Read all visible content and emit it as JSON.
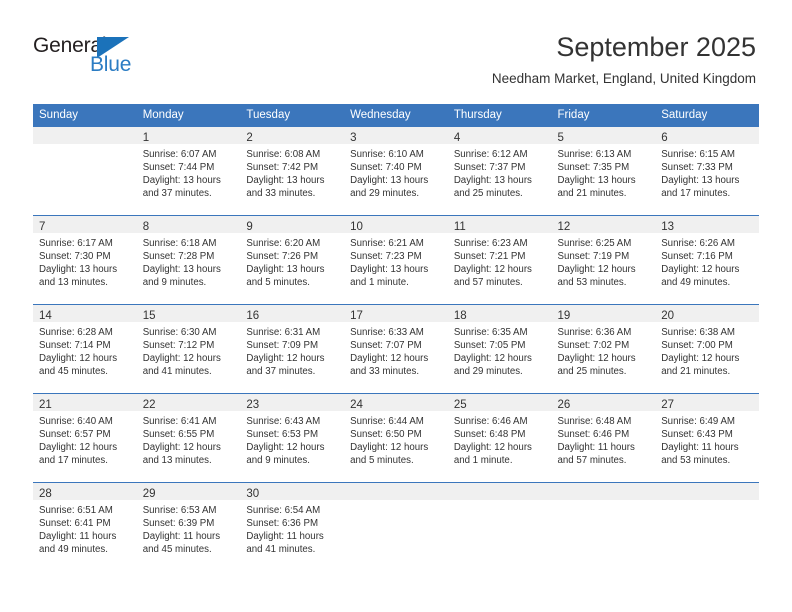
{
  "brand": {
    "name_top": "General",
    "name_bottom": "Blue",
    "triangle_color": "#1b72ba",
    "text_color": "#231f20",
    "blue_color": "#2b7cc3"
  },
  "header": {
    "title": "September 2025",
    "subtitle": "Needham Market, England, United Kingdom",
    "header_bar_color": "#3b76bc"
  },
  "weekdays": [
    "Sunday",
    "Monday",
    "Tuesday",
    "Wednesday",
    "Thursday",
    "Friday",
    "Saturday"
  ],
  "labels": {
    "sunrise_prefix": "Sunrise:",
    "sunset_prefix": "Sunset:",
    "daylight_prefix": "Daylight:"
  },
  "weeks": [
    [
      {
        "empty": true
      },
      {
        "day": "1",
        "sunrise": "Sunrise: 6:07 AM",
        "sunset": "Sunset: 7:44 PM",
        "daylight_line1": "Daylight: 13 hours",
        "daylight_line2": "and 37 minutes."
      },
      {
        "day": "2",
        "sunrise": "Sunrise: 6:08 AM",
        "sunset": "Sunset: 7:42 PM",
        "daylight_line1": "Daylight: 13 hours",
        "daylight_line2": "and 33 minutes."
      },
      {
        "day": "3",
        "sunrise": "Sunrise: 6:10 AM",
        "sunset": "Sunset: 7:40 PM",
        "daylight_line1": "Daylight: 13 hours",
        "daylight_line2": "and 29 minutes."
      },
      {
        "day": "4",
        "sunrise": "Sunrise: 6:12 AM",
        "sunset": "Sunset: 7:37 PM",
        "daylight_line1": "Daylight: 13 hours",
        "daylight_line2": "and 25 minutes."
      },
      {
        "day": "5",
        "sunrise": "Sunrise: 6:13 AM",
        "sunset": "Sunset: 7:35 PM",
        "daylight_line1": "Daylight: 13 hours",
        "daylight_line2": "and 21 minutes."
      },
      {
        "day": "6",
        "sunrise": "Sunrise: 6:15 AM",
        "sunset": "Sunset: 7:33 PM",
        "daylight_line1": "Daylight: 13 hours",
        "daylight_line2": "and 17 minutes."
      }
    ],
    [
      {
        "day": "7",
        "sunrise": "Sunrise: 6:17 AM",
        "sunset": "Sunset: 7:30 PM",
        "daylight_line1": "Daylight: 13 hours",
        "daylight_line2": "and 13 minutes."
      },
      {
        "day": "8",
        "sunrise": "Sunrise: 6:18 AM",
        "sunset": "Sunset: 7:28 PM",
        "daylight_line1": "Daylight: 13 hours",
        "daylight_line2": "and 9 minutes."
      },
      {
        "day": "9",
        "sunrise": "Sunrise: 6:20 AM",
        "sunset": "Sunset: 7:26 PM",
        "daylight_line1": "Daylight: 13 hours",
        "daylight_line2": "and 5 minutes."
      },
      {
        "day": "10",
        "sunrise": "Sunrise: 6:21 AM",
        "sunset": "Sunset: 7:23 PM",
        "daylight_line1": "Daylight: 13 hours",
        "daylight_line2": "and 1 minute."
      },
      {
        "day": "11",
        "sunrise": "Sunrise: 6:23 AM",
        "sunset": "Sunset: 7:21 PM",
        "daylight_line1": "Daylight: 12 hours",
        "daylight_line2": "and 57 minutes."
      },
      {
        "day": "12",
        "sunrise": "Sunrise: 6:25 AM",
        "sunset": "Sunset: 7:19 PM",
        "daylight_line1": "Daylight: 12 hours",
        "daylight_line2": "and 53 minutes."
      },
      {
        "day": "13",
        "sunrise": "Sunrise: 6:26 AM",
        "sunset": "Sunset: 7:16 PM",
        "daylight_line1": "Daylight: 12 hours",
        "daylight_line2": "and 49 minutes."
      }
    ],
    [
      {
        "day": "14",
        "sunrise": "Sunrise: 6:28 AM",
        "sunset": "Sunset: 7:14 PM",
        "daylight_line1": "Daylight: 12 hours",
        "daylight_line2": "and 45 minutes."
      },
      {
        "day": "15",
        "sunrise": "Sunrise: 6:30 AM",
        "sunset": "Sunset: 7:12 PM",
        "daylight_line1": "Daylight: 12 hours",
        "daylight_line2": "and 41 minutes."
      },
      {
        "day": "16",
        "sunrise": "Sunrise: 6:31 AM",
        "sunset": "Sunset: 7:09 PM",
        "daylight_line1": "Daylight: 12 hours",
        "daylight_line2": "and 37 minutes."
      },
      {
        "day": "17",
        "sunrise": "Sunrise: 6:33 AM",
        "sunset": "Sunset: 7:07 PM",
        "daylight_line1": "Daylight: 12 hours",
        "daylight_line2": "and 33 minutes."
      },
      {
        "day": "18",
        "sunrise": "Sunrise: 6:35 AM",
        "sunset": "Sunset: 7:05 PM",
        "daylight_line1": "Daylight: 12 hours",
        "daylight_line2": "and 29 minutes."
      },
      {
        "day": "19",
        "sunrise": "Sunrise: 6:36 AM",
        "sunset": "Sunset: 7:02 PM",
        "daylight_line1": "Daylight: 12 hours",
        "daylight_line2": "and 25 minutes."
      },
      {
        "day": "20",
        "sunrise": "Sunrise: 6:38 AM",
        "sunset": "Sunset: 7:00 PM",
        "daylight_line1": "Daylight: 12 hours",
        "daylight_line2": "and 21 minutes."
      }
    ],
    [
      {
        "day": "21",
        "sunrise": "Sunrise: 6:40 AM",
        "sunset": "Sunset: 6:57 PM",
        "daylight_line1": "Daylight: 12 hours",
        "daylight_line2": "and 17 minutes."
      },
      {
        "day": "22",
        "sunrise": "Sunrise: 6:41 AM",
        "sunset": "Sunset: 6:55 PM",
        "daylight_line1": "Daylight: 12 hours",
        "daylight_line2": "and 13 minutes."
      },
      {
        "day": "23",
        "sunrise": "Sunrise: 6:43 AM",
        "sunset": "Sunset: 6:53 PM",
        "daylight_line1": "Daylight: 12 hours",
        "daylight_line2": "and 9 minutes."
      },
      {
        "day": "24",
        "sunrise": "Sunrise: 6:44 AM",
        "sunset": "Sunset: 6:50 PM",
        "daylight_line1": "Daylight: 12 hours",
        "daylight_line2": "and 5 minutes."
      },
      {
        "day": "25",
        "sunrise": "Sunrise: 6:46 AM",
        "sunset": "Sunset: 6:48 PM",
        "daylight_line1": "Daylight: 12 hours",
        "daylight_line2": "and 1 minute."
      },
      {
        "day": "26",
        "sunrise": "Sunrise: 6:48 AM",
        "sunset": "Sunset: 6:46 PM",
        "daylight_line1": "Daylight: 11 hours",
        "daylight_line2": "and 57 minutes."
      },
      {
        "day": "27",
        "sunrise": "Sunrise: 6:49 AM",
        "sunset": "Sunset: 6:43 PM",
        "daylight_line1": "Daylight: 11 hours",
        "daylight_line2": "and 53 minutes."
      }
    ],
    [
      {
        "day": "28",
        "sunrise": "Sunrise: 6:51 AM",
        "sunset": "Sunset: 6:41 PM",
        "daylight_line1": "Daylight: 11 hours",
        "daylight_line2": "and 49 minutes."
      },
      {
        "day": "29",
        "sunrise": "Sunrise: 6:53 AM",
        "sunset": "Sunset: 6:39 PM",
        "daylight_line1": "Daylight: 11 hours",
        "daylight_line2": "and 45 minutes."
      },
      {
        "day": "30",
        "sunrise": "Sunrise: 6:54 AM",
        "sunset": "Sunset: 6:36 PM",
        "daylight_line1": "Daylight: 11 hours",
        "daylight_line2": "and 41 minutes."
      },
      {
        "empty": true
      },
      {
        "empty": true
      },
      {
        "empty": true
      },
      {
        "empty": true
      }
    ]
  ]
}
